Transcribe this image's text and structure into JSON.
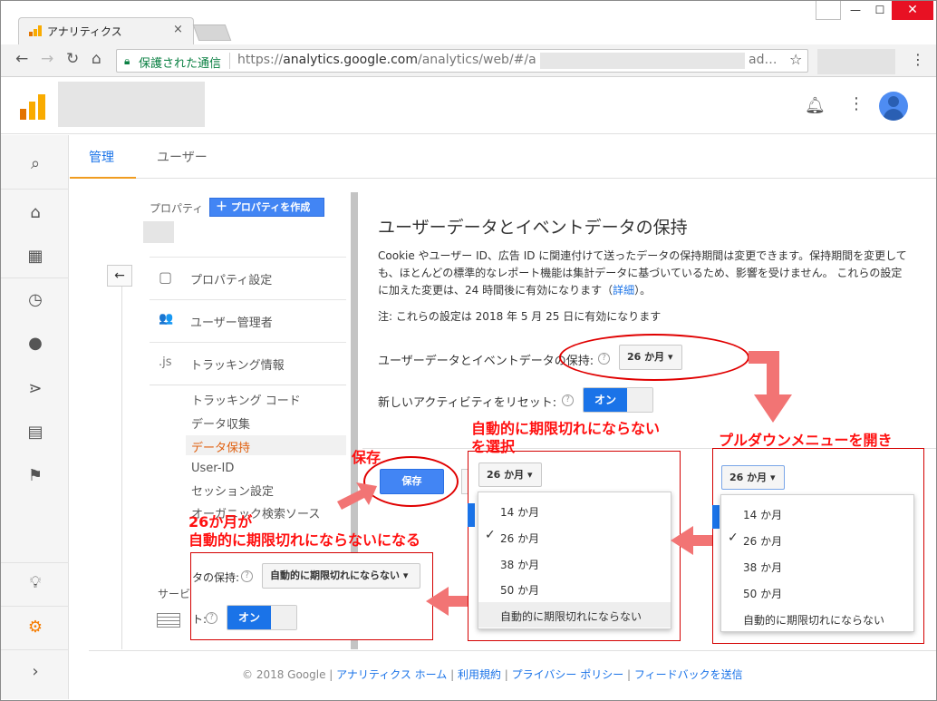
{
  "browser": {
    "tab_title": "アナリティクス",
    "tab_close": "×",
    "secure_label": "保護された通信",
    "url_scheme": "https://",
    "url_host": "analytics.google.com",
    "url_path": "/analytics/web/#/a",
    "url_tail": "ad…",
    "win_min": "—",
    "win_max": "☐",
    "win_close": "✕"
  },
  "tabs": {
    "admin": "管理",
    "user": "ユーザー"
  },
  "property": {
    "label": "プロパティ",
    "create_button": "プロパティを作成"
  },
  "nav": {
    "back": "←",
    "items": [
      {
        "label": "プロパティ設定",
        "icon": "▢"
      },
      {
        "label": "ユーザー管理者",
        "icon": "👥"
      },
      {
        "label": "トラッキング情報",
        "icon": ".js"
      }
    ],
    "subitems": [
      "トラッキング コード",
      "データ収集",
      "データ保持",
      "User-ID",
      "セッション設定",
      "オーガニック検索ソース"
    ],
    "active_sub": "データ保持",
    "service_label": "サービ"
  },
  "main": {
    "title": "ユーザーデータとイベントデータの保持",
    "desc_1": "Cookie やユーザー ID、広告 ID に関連付けて送ったデータの保持期間は変更できます。保持期間を変更しても、ほとんどの標準的なレポート機能は集計データに基づいているため、影響を受けません。 これらの設定に加えた変更は、24 時間後に有効になります（",
    "desc_link": "詳細",
    "desc_2": "）。",
    "note": "注: これらの設定は 2018 年 5 月 25 日に有効になります",
    "retention_label": "ユーザーデータとイベントデータの保持:",
    "retention_value": "26 か月",
    "reset_label": "新しいアクティビティをリセット:",
    "reset_value": "オン",
    "help": "?"
  },
  "dropdown_menu": {
    "options": [
      "14 か月",
      "26 か月",
      "38 か月",
      "50 か月",
      "自動的に期限切れにならない"
    ],
    "selected": "26 か月",
    "check": "✓"
  },
  "result_box": {
    "label_fragment": "タの保持:",
    "value": "自動的に期限切れにならない",
    "toggle_label_fragment": "ト:",
    "toggle": "オン"
  },
  "save_button": "保存",
  "annotations": {
    "open_menu": "プルダウンメニューを開き",
    "select_line1": "自動的に期限切れにならない",
    "select_line2": "を選択",
    "save": "保存",
    "result_line1": "26か月が",
    "result_line2": "自動的に期限切れにならないになる"
  },
  "footer": {
    "copyright": "© 2018 Google",
    "links": [
      "アナリティクス ホーム",
      "利用規約",
      "プライバシー ポリシー",
      "フィードバックを送信"
    ]
  },
  "colors": {
    "accent": "#1a73e8",
    "annotation_red": "#ff1010",
    "arrow": "#f27474",
    "ga_orange": "#f9ab00"
  }
}
